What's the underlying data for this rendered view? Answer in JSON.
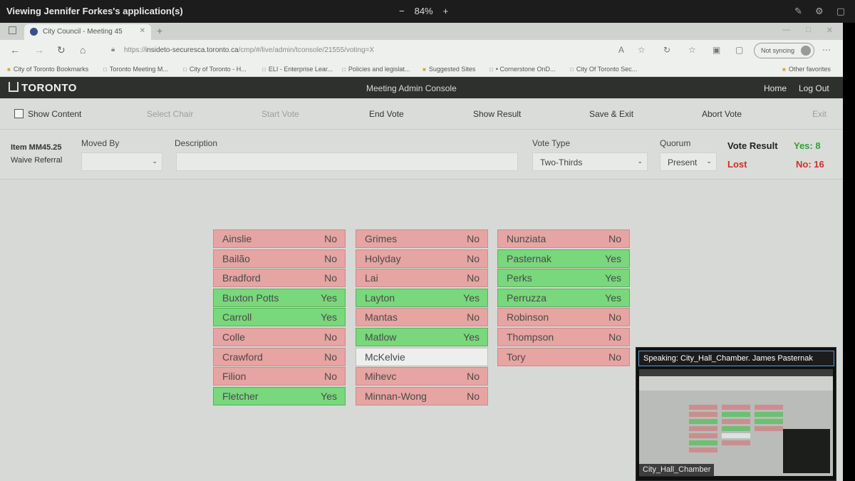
{
  "share": {
    "title": "Viewing Jennifer Forkes's application(s)",
    "zoom_out": "−",
    "zoom": "84%",
    "zoom_in": "+"
  },
  "browser": {
    "tab_title": "City Council - Meeting 45",
    "url_prefix": "https://",
    "url_host": "insideto-securesca.toronto.ca",
    "url_path": "/cmp/#/live/admin/tconsole/21555/voting=X",
    "not_syncing": "Not syncing",
    "bookmarks": [
      "City of Toronto Bookmarks",
      "Toronto Meeting M...",
      "City of Toronto - H...",
      "ELI - Enterprise Lear...",
      "Policies and legislat...",
      "Suggested Sites",
      "• Cornerstone OnD...",
      "City Of Toronto Sec..."
    ],
    "other_favorites": "Other favorites"
  },
  "header": {
    "logo": "TORONTO",
    "title": "Meeting Admin Console",
    "home": "Home",
    "logout": "Log Out"
  },
  "toolbar": {
    "show_content": "Show Content",
    "select_chair": "Select Chair",
    "start_vote": "Start Vote",
    "end_vote": "End Vote",
    "show_result": "Show Result",
    "save_exit": "Save & Exit",
    "abort_vote": "Abort Vote",
    "exit": "Exit"
  },
  "item": {
    "id": "Item MM45.25",
    "desc": "Waive Referral",
    "moved_by_label": "Moved By",
    "moved_by_value": "",
    "description_label": "Description",
    "description_value": "",
    "vote_type_label": "Vote Type",
    "vote_type_value": "Two-Thirds",
    "quorum_label": "Quorum",
    "quorum_value": "Present",
    "vote_result_label": "Vote Result",
    "result": "Lost",
    "yes_total": "Yes: 8",
    "no_total": "No: 16"
  },
  "colors": {
    "yes": "#79d77c",
    "no": "#e6a4a2",
    "absent": "#eeeeee",
    "lost": "#d72a2a",
    "yes_text": "#3a9a3a"
  },
  "votes": {
    "col1": [
      {
        "name": "Ainslie",
        "vote": "No"
      },
      {
        "name": "Bailão",
        "vote": "No"
      },
      {
        "name": "Bradford",
        "vote": "No"
      },
      {
        "name": "Buxton Potts",
        "vote": "Yes"
      },
      {
        "name": "Carroll",
        "vote": "Yes"
      },
      {
        "name": "Colle",
        "vote": "No"
      },
      {
        "name": "Crawford",
        "vote": "No"
      },
      {
        "name": "Filion",
        "vote": "No"
      },
      {
        "name": "Fletcher",
        "vote": "Yes"
      }
    ],
    "col2": [
      {
        "name": "Grimes",
        "vote": "No"
      },
      {
        "name": "Holyday",
        "vote": "No"
      },
      {
        "name": "Lai",
        "vote": "No"
      },
      {
        "name": "Layton",
        "vote": "Yes"
      },
      {
        "name": "Mantas",
        "vote": "No"
      },
      {
        "name": "Matlow",
        "vote": "Yes"
      },
      {
        "name": "McKelvie",
        "vote": ""
      },
      {
        "name": "Mihevc",
        "vote": "No"
      },
      {
        "name": "Minnan-Wong",
        "vote": "No"
      }
    ],
    "col3": [
      {
        "name": "Nunziata",
        "vote": "No"
      },
      {
        "name": "Pasternak",
        "vote": "Yes"
      },
      {
        "name": "Perks",
        "vote": "Yes"
      },
      {
        "name": "Perruzza",
        "vote": "Yes"
      },
      {
        "name": "Robinson",
        "vote": "No"
      },
      {
        "name": "Thompson",
        "vote": "No"
      },
      {
        "name": "Tory",
        "vote": "No"
      }
    ]
  },
  "speaker": {
    "label": "Speaking:",
    "name": "City_Hall_Chamber. James Pasternak",
    "caption": "City_Hall_Chamber"
  }
}
